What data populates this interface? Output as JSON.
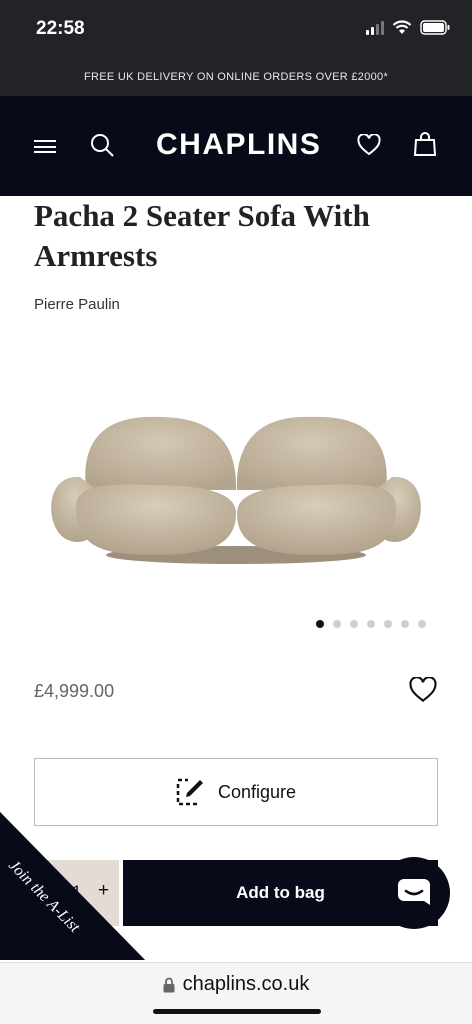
{
  "status_bar": {
    "time": "22:58"
  },
  "promo": {
    "text": "FREE UK DELIVERY ON ONLINE ORDERS OVER £2000*"
  },
  "nav": {
    "logo": "CHAPLINS"
  },
  "product": {
    "title": "Pacha 2 Seater Sofa With Armrests",
    "designer": "Pierre Paulin",
    "price": "£4,999.00",
    "image_count": 7,
    "active_image": 1
  },
  "actions": {
    "configure_label": "Configure",
    "quantity": "1",
    "plus_label": "+",
    "add_to_bag_label": "Add to bag"
  },
  "promo_ribbon": {
    "text": "Join the A-List"
  },
  "browser": {
    "url": "chaplins.co.uk"
  },
  "colors": {
    "navy": "#080a1a",
    "sofa": "#c9bba5",
    "qty_bg": "#e3dcd4"
  }
}
